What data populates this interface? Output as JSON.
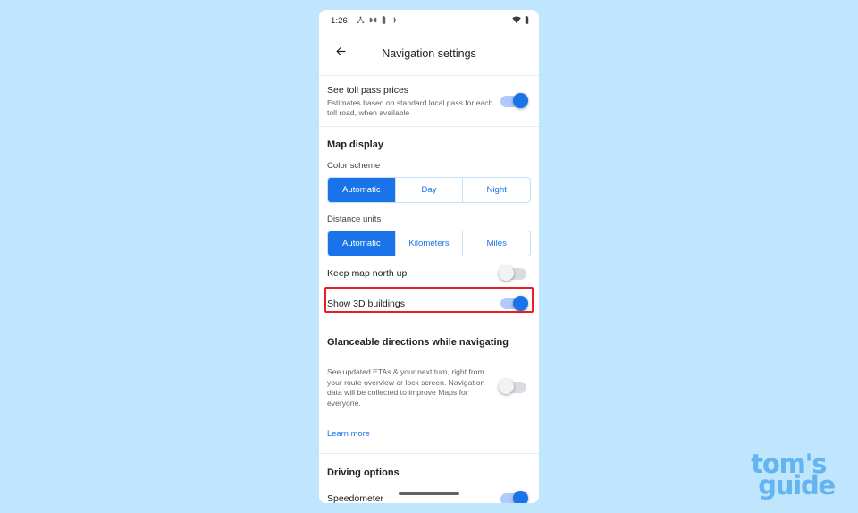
{
  "colors": {
    "page_background": "#bfe6fc",
    "accent_blue": "#1a73e8",
    "highlight_red": "#ec1c24",
    "watermark_blue": "#63b4f0"
  },
  "status_bar": {
    "time": "1:26",
    "left_icons": [
      "share-nodes-icon",
      "do-not-disturb-icon",
      "battery-saver-icon",
      "bluetooth-sharing-icon"
    ],
    "right_icons": [
      "wifi-icon",
      "battery-icon"
    ]
  },
  "app_bar": {
    "back_icon": "arrow-left-icon",
    "title": "Navigation settings"
  },
  "sections": {
    "toll": {
      "title": "See toll pass prices",
      "subtitle": "Estimates based on standard local pass for each toll road, when available",
      "toggle_state": "on"
    },
    "map_display": {
      "header": "Map display",
      "color_scheme": {
        "label": "Color scheme",
        "options": [
          "Automatic",
          "Day",
          "Night"
        ],
        "selected": "Automatic"
      },
      "distance_units": {
        "label": "Distance units",
        "options": [
          "Automatic",
          "Kilometers",
          "Miles"
        ],
        "selected": "Automatic"
      },
      "keep_north_up": {
        "title": "Keep map north up",
        "toggle_state": "off"
      },
      "show_3d_buildings": {
        "title": "Show 3D buildings",
        "toggle_state": "on",
        "highlighted": true
      }
    },
    "glanceable": {
      "header": "Glanceable directions while navigating",
      "description": "See updated ETAs & your next turn, right from your route overview or lock screen. Navigation data will be collected to improve Maps for everyone.",
      "toggle_state": "off",
      "learn_more": "Learn more"
    },
    "driving": {
      "header": "Driving options",
      "speedometer": {
        "title": "Speedometer",
        "toggle_state": "on"
      }
    }
  },
  "watermark": {
    "line1": "tom's",
    "line2": "guide"
  }
}
